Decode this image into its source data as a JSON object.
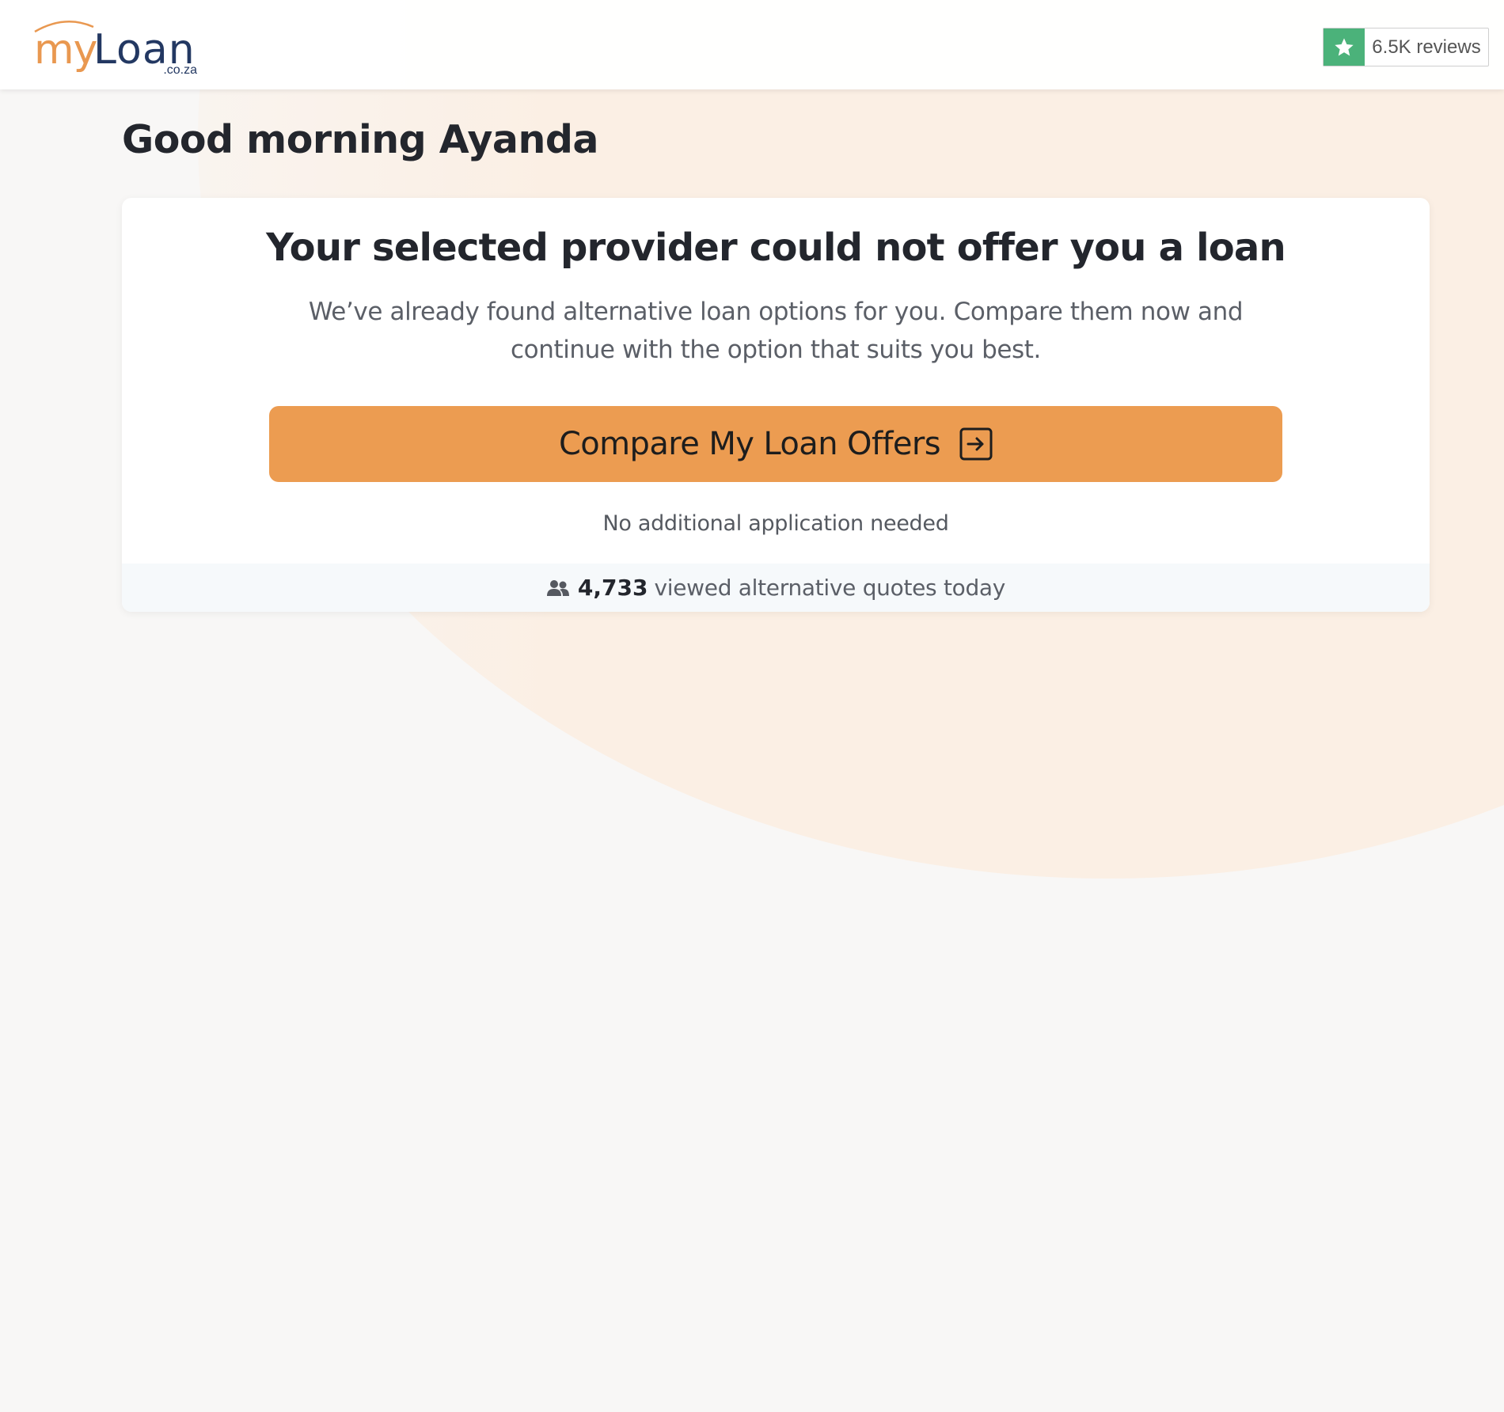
{
  "header": {
    "logo": {
      "part1": "my",
      "part2": "Loan",
      "domain": ".co.za"
    },
    "reviews": {
      "icon": "star-icon",
      "label": "6.5K reviews"
    }
  },
  "greeting": "Good morning Ayanda",
  "card": {
    "title": "Your selected provider could not offer you a loan",
    "subtitle": "We’ve already found alternative loan options for you. Compare them now and continue with the option that suits you best.",
    "cta": {
      "label": "Compare My Loan Offers",
      "icon": "arrow-right-box-icon"
    },
    "note": "No additional application needed",
    "social_proof": {
      "icon": "people-icon",
      "count": "4,733",
      "label": "viewed alternative quotes today"
    }
  },
  "colors": {
    "brand_orange": "#ec9c51",
    "brand_navy": "#233862",
    "trust_green": "#4bb27a"
  }
}
